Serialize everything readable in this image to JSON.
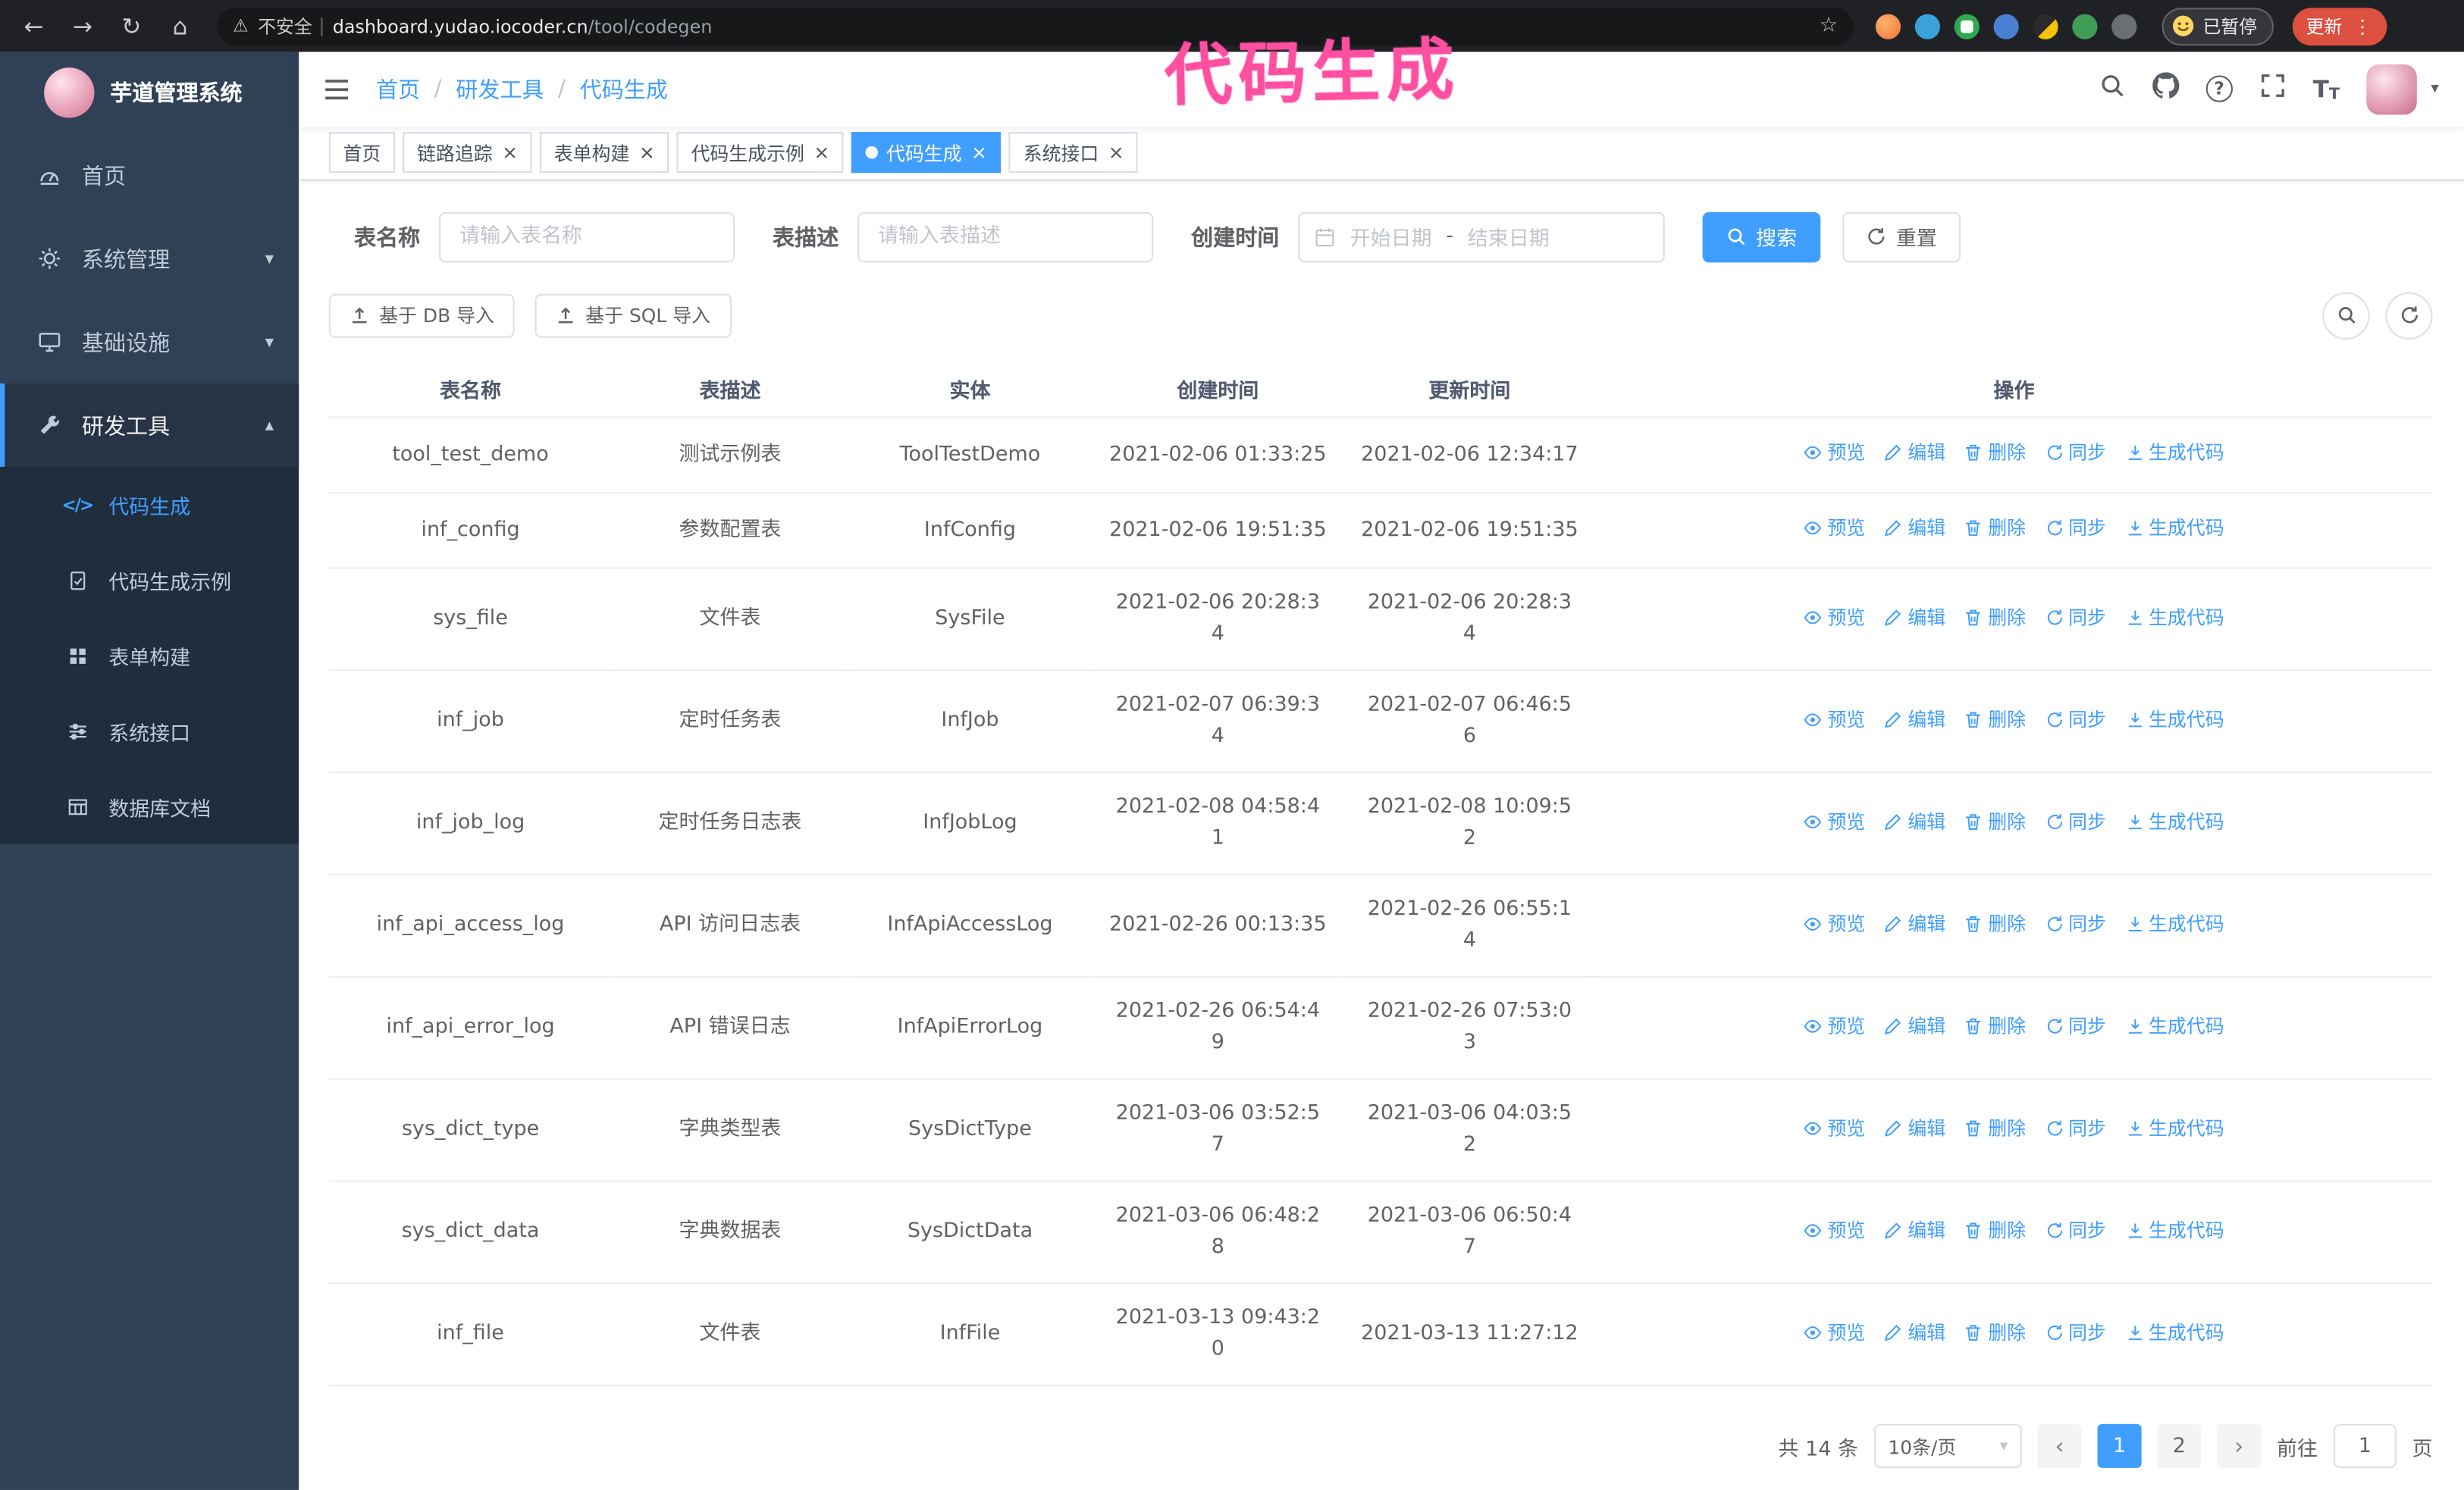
{
  "browser": {
    "security_label": "不安全",
    "url_host": "dashboard.yudao.iocoder.cn",
    "url_path": "/tool/codegen",
    "paused_label": "已暂停",
    "update_label": "更新"
  },
  "annotation": "代码生成",
  "icons": {
    "back": "←",
    "forward": "→",
    "reload": "↻",
    "home": "⌂",
    "warning": "⚠",
    "star": "☆",
    "kebab": "⋮",
    "close": "×",
    "caret_down": "▾",
    "caret_up": "▴",
    "prev": "‹",
    "next": "›",
    "question": "?",
    "font_large": "T",
    "font_small": "T",
    "code": "</>",
    "slash": "/"
  },
  "colors": {
    "accent": "#409eff",
    "sidebar_bg": "#304156",
    "submenu_bg": "#1f2d3d",
    "update_button": "#dd4f3e",
    "annotation": "#ff4fa0"
  },
  "sidebar": {
    "logo_title": "芋道管理系统",
    "items": [
      {
        "label": "首页"
      },
      {
        "label": "系统管理"
      },
      {
        "label": "基础设施"
      },
      {
        "label": "研发工具",
        "active": true
      }
    ],
    "subitems": [
      {
        "label": "代码生成",
        "active": true
      },
      {
        "label": "代码生成示例"
      },
      {
        "label": "表单构建"
      },
      {
        "label": "系统接口"
      },
      {
        "label": "数据库文档"
      }
    ]
  },
  "breadcrumb": [
    "首页",
    "研发工具",
    "代码生成"
  ],
  "tags": [
    {
      "label": "首页"
    },
    {
      "label": "链路追踪"
    },
    {
      "label": "表单构建"
    },
    {
      "label": "代码生成示例"
    },
    {
      "label": "代码生成",
      "active": true
    },
    {
      "label": "系统接口"
    }
  ],
  "filters": {
    "table_name_label": "表名称",
    "table_name_placeholder": "请输入表名称",
    "table_desc_label": "表描述",
    "table_desc_placeholder": "请输入表描述",
    "create_time_label": "创建时间",
    "date_start_placeholder": "开始日期",
    "date_separator": "-",
    "date_end_placeholder": "结束日期",
    "search_label": "搜索",
    "reset_label": "重置"
  },
  "toolbar": {
    "import_db_label": "基于 DB 导入",
    "import_sql_label": "基于 SQL 导入"
  },
  "table": {
    "columns": [
      "表名称",
      "表描述",
      "实体",
      "创建时间",
      "更新时间",
      "操作"
    ],
    "action_labels": [
      "预览",
      "编辑",
      "删除",
      "同步",
      "生成代码"
    ],
    "rows": [
      {
        "name": "tool_test_demo",
        "desc": "测试示例表",
        "entity": "ToolTestDemo",
        "created": "2021-02-06 01:33:25",
        "updated": "2021-02-06 12:34:17"
      },
      {
        "name": "inf_config",
        "desc": "参数配置表",
        "entity": "InfConfig",
        "created": "2021-02-06 19:51:35",
        "updated": "2021-02-06 19:51:35"
      },
      {
        "name": "sys_file",
        "desc": "文件表",
        "entity": "SysFile",
        "created": "2021-02-06 20:28:3\n4",
        "updated": "2021-02-06 20:28:3\n4"
      },
      {
        "name": "inf_job",
        "desc": "定时任务表",
        "entity": "InfJob",
        "created": "2021-02-07 06:39:3\n4",
        "updated": "2021-02-07 06:46:5\n6"
      },
      {
        "name": "inf_job_log",
        "desc": "定时任务日志表",
        "entity": "InfJobLog",
        "created": "2021-02-08 04:58:4\n1",
        "updated": "2021-02-08 10:09:5\n2"
      },
      {
        "name": "inf_api_access_log",
        "desc": "API 访问日志表",
        "entity": "InfApiAccessLog",
        "created": "2021-02-26 00:13:35",
        "updated": "2021-02-26 06:55:1\n4"
      },
      {
        "name": "inf_api_error_log",
        "desc": "API 错误日志",
        "entity": "InfApiErrorLog",
        "created": "2021-02-26 06:54:4\n9",
        "updated": "2021-02-26 07:53:0\n3"
      },
      {
        "name": "sys_dict_type",
        "desc": "字典类型表",
        "entity": "SysDictType",
        "created": "2021-03-06 03:52:5\n7",
        "updated": "2021-03-06 04:03:5\n2"
      },
      {
        "name": "sys_dict_data",
        "desc": "字典数据表",
        "entity": "SysDictData",
        "created": "2021-03-06 06:48:2\n8",
        "updated": "2021-03-06 06:50:4\n7"
      },
      {
        "name": "inf_file",
        "desc": "文件表",
        "entity": "InfFile",
        "created": "2021-03-13 09:43:2\n0",
        "updated": "2021-03-13 11:27:12"
      }
    ]
  },
  "pagination": {
    "total_label": "共 14 条",
    "page_size_label": "10条/页",
    "pages": [
      "1",
      "2"
    ],
    "active_page": "1",
    "goto_label": "前往",
    "goto_value": "1",
    "goto_suffix": "页"
  }
}
